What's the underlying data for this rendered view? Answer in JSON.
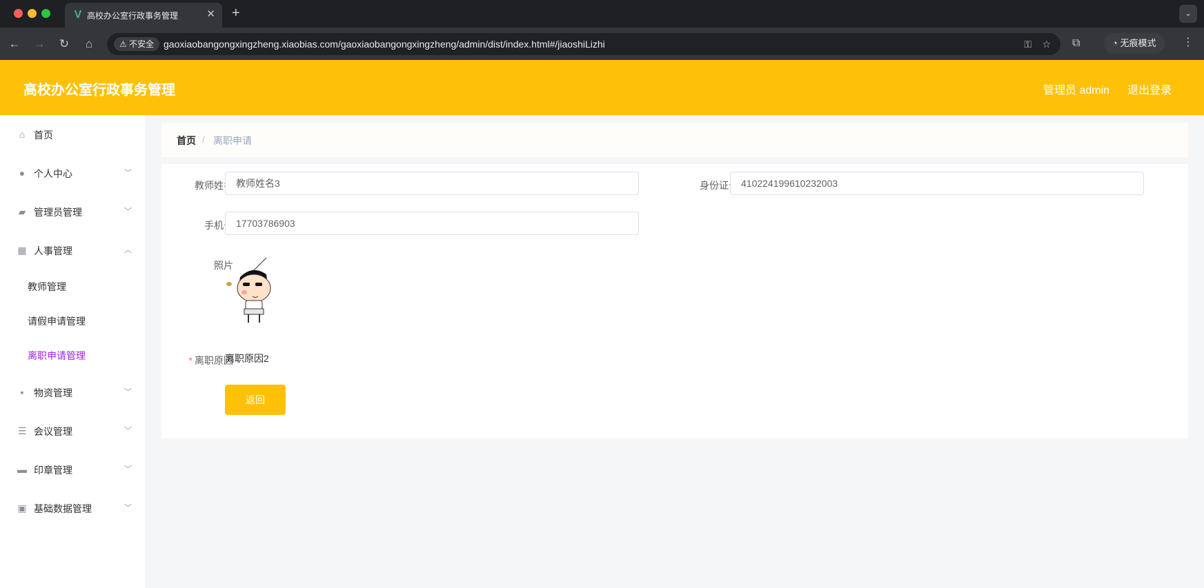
{
  "browser": {
    "tab_title": "高校办公室行政事务管理",
    "security_label": "不安全",
    "url": "gaoxiaobangongxingzheng.xiaobias.com/gaoxiaobangongxingzheng/admin/dist/index.html#/jiaoshiLizhi",
    "incognito_label": "无痕模式"
  },
  "header": {
    "title": "高校办公室行政事务管理",
    "user_label": "管理员 admin",
    "logout_label": "退出登录",
    "accent_color": "#ffc107"
  },
  "sidebar": {
    "items": [
      {
        "label": "首页",
        "icon": "home-icon"
      },
      {
        "label": "个人中心",
        "icon": "user-icon"
      },
      {
        "label": "管理员管理",
        "icon": "ticket-icon"
      },
      {
        "label": "人事管理",
        "icon": "grid-icon"
      },
      {
        "label": "物资管理",
        "icon": "chat-icon"
      },
      {
        "label": "会议管理",
        "icon": "list-icon"
      },
      {
        "label": "印章管理",
        "icon": "shop-icon"
      },
      {
        "label": "基础数据管理",
        "icon": "clipboard-icon"
      }
    ],
    "submenu": [
      {
        "label": "教师管理"
      },
      {
        "label": "请假申请管理"
      },
      {
        "label": "离职申请管理",
        "active": true
      }
    ],
    "active_color": "#a020f0"
  },
  "breadcrumb": {
    "home": "首页",
    "separator": "/",
    "current": "离职申请"
  },
  "form": {
    "teacher_name_label": "教师姓名",
    "teacher_name_value": "教师姓名3",
    "id_card_label": "身份证号",
    "id_card_value": "410224199610232003",
    "phone_label": "手机号",
    "phone_value": "17703786903",
    "photo_label": "照片",
    "reason_label": "离职原因",
    "reason_value": "离职原因2",
    "back_button": "返回"
  }
}
